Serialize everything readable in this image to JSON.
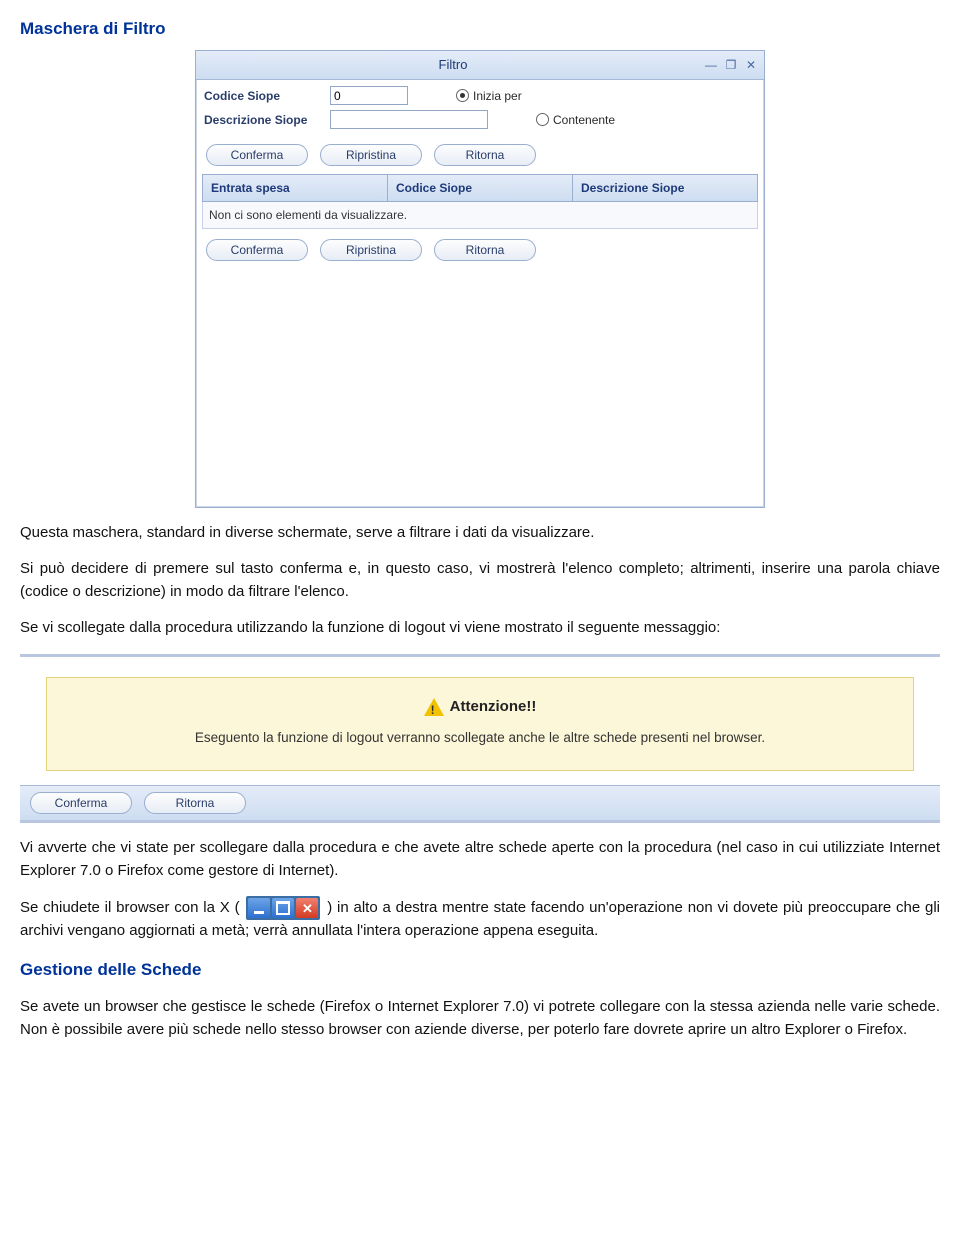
{
  "heading1": "Maschera di Filtro",
  "filtro": {
    "title": "Filtro",
    "label_codice": "Codice Siope",
    "value_codice": "0",
    "label_descrizione": "Descrizione Siope",
    "value_descrizione": "",
    "radio_inizia": "Inizia per",
    "radio_contenente": "Contenente",
    "btn_conferma": "Conferma",
    "btn_ripristina": "Ripristina",
    "btn_ritorna": "Ritorna",
    "col1": "Entrata spesa",
    "col2": "Codice Siope",
    "col3": "Descrizione Siope",
    "empty_msg": "Non ci sono elementi da visualizzare."
  },
  "para1": "Questa maschera, standard in diverse schermate, serve a filtrare i dati da visualizzare.",
  "para2": "Si può decidere di premere sul tasto conferma e, in questo caso, vi mostrerà l'elenco completo; altrimenti, inserire una parola chiave (codice o descrizione) in modo da filtrare l'elenco.",
  "para3": "Se vi scollegate dalla procedura utilizzando la funzione di logout vi viene mostrato il seguente messaggio:",
  "warn": {
    "title": "Attenzione!!",
    "msg": "Eseguento la funzione di logout verranno scollegate anche le altre schede presenti nel browser.",
    "btn_conferma": "Conferma",
    "btn_ritorna": "Ritorna"
  },
  "para4": "Vi avverte che vi state per scollegare dalla procedura e che avete altre schede aperte con la procedura (nel caso in cui utilizziate Internet Explorer 7.0 o Firefox come gestore di Internet).",
  "para5a": "Se chiudete il browser con la X (",
  "para5b": ") in alto a destra mentre state facendo un'operazione non vi dovete più preoccupare che gli archivi vengano aggiornati a metà; verrà annullata l'intera operazione appena eseguita.",
  "heading2": "Gestione delle Schede",
  "para6": "Se avete un browser che gestisce le schede (Firefox o Internet Explorer 7.0) vi potrete collegare con la stessa azienda nelle varie schede. Non è possibile avere più schede nello stesso browser con aziende diverse, per poterlo fare dovrete aprire un altro Explorer o Firefox."
}
